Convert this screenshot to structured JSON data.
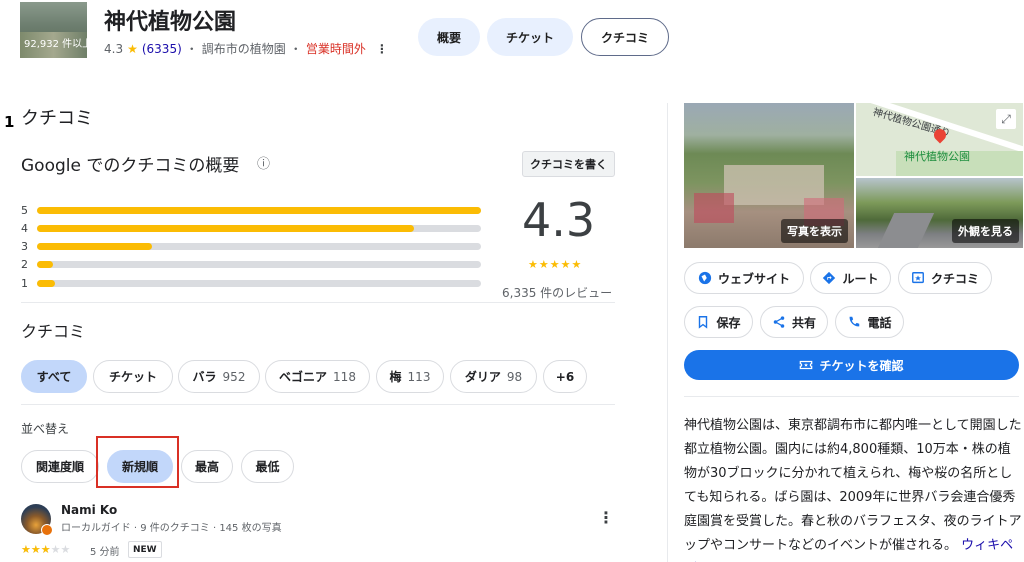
{
  "header": {
    "place_name": "神代植物公園",
    "thumb_count": "92,932 件以上",
    "rating": "4.3",
    "star": "★",
    "reviews_count": "(6335)",
    "sep": "・",
    "category": "調布市の植物園",
    "status": "営業時間外",
    "more": "⋮",
    "tabs": [
      {
        "label": "概要"
      },
      {
        "label": "チケット"
      },
      {
        "label": "クチコミ"
      }
    ]
  },
  "annotation_number": "1",
  "reviews_section": {
    "heading": "クチコミ",
    "summary_title": "Google でのクチコミの概要",
    "info_icon": "ⓘ",
    "write_button": "クチコミを書く",
    "rating_big": "4.3",
    "stars_text": "★★★★★",
    "rating_value": 4.3,
    "review_count_label": "6,335 件のレビュー",
    "distribution": [
      {
        "label": "5",
        "fraction": 1.0
      },
      {
        "label": "4",
        "fraction": 0.85
      },
      {
        "label": "3",
        "fraction": 0.26
      },
      {
        "label": "2",
        "fraction": 0.035
      },
      {
        "label": "1",
        "fraction": 0.04
      }
    ],
    "topics_heading": "クチコミ",
    "topics": [
      {
        "label": "すべて",
        "count": ""
      },
      {
        "label": "チケット",
        "count": ""
      },
      {
        "label": "バラ",
        "count": "952"
      },
      {
        "label": "ベゴニア",
        "count": "118"
      },
      {
        "label": "梅",
        "count": "113"
      },
      {
        "label": "ダリア",
        "count": "98"
      },
      {
        "label": "+6",
        "count": ""
      }
    ],
    "sort_label": "並べ替え",
    "sort_options": [
      {
        "label": "関連度順"
      },
      {
        "label": "新規順"
      },
      {
        "label": "最高"
      },
      {
        "label": "最低"
      }
    ]
  },
  "review": {
    "author": "Nami Ko",
    "meta": "ローカルガイド · 9 件のクチコミ · 145 枚の写真",
    "stars_text": "★★★★★",
    "rating": 3,
    "time": "5 分前",
    "badge": "NEW",
    "more": "⋮"
  },
  "side": {
    "photo_label": "写真を表示",
    "streetview_label": "外観を見る",
    "map_road_label": "神代植物公園通り",
    "map_pin_label": "神代植物公園",
    "actions": [
      {
        "label": "ウェブサイト"
      },
      {
        "label": "ルート"
      },
      {
        "label": "クチコミ"
      },
      {
        "label": "保存"
      },
      {
        "label": "共有"
      },
      {
        "label": "電話"
      }
    ],
    "ticket_button": "チケットを確認",
    "description": "神代植物公園は、東京都調布市に都内唯一として開園した都立植物公園。園内には約4,800種類、10万本・株の植物が30ブロックに分かれて植えられ、梅や桜の名所としても知られる。ばら園は、2009年に世界バラ会連合優秀庭園賞を受賞した。春と秋のバラフェスタ、夜のライトアップやコンサートなどのイベントが催される。",
    "wiki_link": "ウィキペディア"
  },
  "colors": {
    "accent": "#1a73e8",
    "star": "#fbbc04",
    "closed": "#d93025",
    "highlight_box": "#d93025"
  }
}
